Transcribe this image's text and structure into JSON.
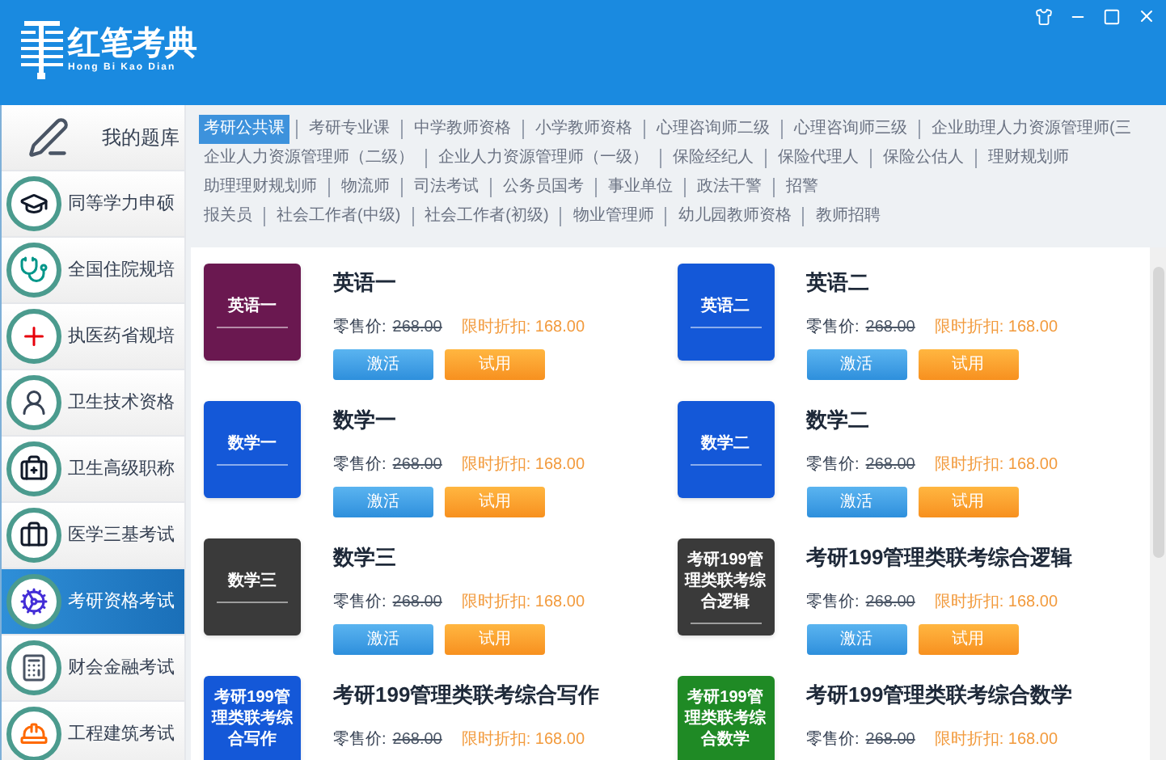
{
  "app": {
    "title": "红笔考典",
    "subtitle": "Hong Bi Kao Dian"
  },
  "sidebar": {
    "items": [
      {
        "label": "我的题库",
        "kind": "featured",
        "selected": false
      },
      {
        "label": "同等学力申硕",
        "kind": "circle",
        "selected": false
      },
      {
        "label": "全国住院规培",
        "kind": "circle",
        "selected": false
      },
      {
        "label": "执医药省规培",
        "kind": "circle",
        "selected": false
      },
      {
        "label": "卫生技术资格",
        "kind": "circle",
        "selected": false
      },
      {
        "label": "卫生高级职称",
        "kind": "circle",
        "selected": false
      },
      {
        "label": "医学三基考试",
        "kind": "circle",
        "selected": false
      },
      {
        "label": "考研资格考试",
        "kind": "circle",
        "selected": true
      },
      {
        "label": "财会金融考试",
        "kind": "circle",
        "selected": false
      },
      {
        "label": "工程建筑考试",
        "kind": "circle",
        "selected": false
      }
    ]
  },
  "categories": [
    [
      {
        "label": "考研公共课",
        "selected": true
      },
      {
        "label": "考研专业课",
        "selected": false
      },
      {
        "label": "中学教师资格",
        "selected": false
      },
      {
        "label": "小学教师资格",
        "selected": false
      },
      {
        "label": "心理咨询师二级",
        "selected": false
      },
      {
        "label": "心理咨询师三级",
        "selected": false
      },
      {
        "label": "企业助理人力资源管理师(三",
        "selected": false
      }
    ],
    [
      {
        "label": "企业人力资源管理师（二级）",
        "selected": false
      },
      {
        "label": "企业人力资源管理师（一级）",
        "selected": false
      },
      {
        "label": "保险经纪人",
        "selected": false
      },
      {
        "label": "保险代理人",
        "selected": false
      },
      {
        "label": "保险公估人",
        "selected": false
      },
      {
        "label": "理财规划师",
        "selected": false
      }
    ],
    [
      {
        "label": "助理理财规划师",
        "selected": false
      },
      {
        "label": "物流师",
        "selected": false
      },
      {
        "label": "司法考试",
        "selected": false
      },
      {
        "label": "公务员国考",
        "selected": false
      },
      {
        "label": "事业单位",
        "selected": false
      },
      {
        "label": "政法干警",
        "selected": false
      },
      {
        "label": "招警",
        "selected": false
      }
    ],
    [
      {
        "label": "报关员",
        "selected": false
      },
      {
        "label": "社会工作者(中级)",
        "selected": false
      },
      {
        "label": "社会工作者(初级)",
        "selected": false
      },
      {
        "label": "物业管理师",
        "selected": false
      },
      {
        "label": "幼儿园教师资格",
        "selected": false
      },
      {
        "label": "教师招聘",
        "selected": false
      }
    ]
  ],
  "products": [
    {
      "cover": "英语一",
      "color": "#6a1850",
      "title": "英语一",
      "retail_label": "零售价:",
      "retail_price": "268.00",
      "discount": "限时折扣: 168.00",
      "buttons": [
        "激活",
        "试用"
      ]
    },
    {
      "cover": "英语二",
      "color": "#1458d8",
      "title": "英语二",
      "retail_label": "零售价:",
      "retail_price": "268.00",
      "discount": "限时折扣: 168.00",
      "buttons": [
        "激活",
        "试用"
      ]
    },
    {
      "cover": "数学一",
      "color": "#1458d8",
      "title": "数学一",
      "retail_label": "零售价:",
      "retail_price": "268.00",
      "discount": "限时折扣: 168.00",
      "buttons": [
        "激活",
        "试用"
      ]
    },
    {
      "cover": "数学二",
      "color": "#1458d8",
      "title": "数学二",
      "retail_label": "零售价:",
      "retail_price": "268.00",
      "discount": "限时折扣: 168.00",
      "buttons": [
        "激活",
        "试用"
      ]
    },
    {
      "cover": "数学三",
      "color": "#3a3a3a",
      "title": "数学三",
      "retail_label": "零售价:",
      "retail_price": "268.00",
      "discount": "限时折扣: 168.00",
      "buttons": [
        "激活",
        "试用"
      ]
    },
    {
      "cover": "考研199管理类联考综合逻辑",
      "color": "#3a3a3a",
      "title": "考研199管理类联考综合逻辑",
      "retail_label": "零售价:",
      "retail_price": "268.00",
      "discount": "限时折扣: 168.00",
      "buttons": [
        "激活",
        "试用"
      ]
    },
    {
      "cover": "考研199管理类联考综合写作",
      "color": "#1458d8",
      "title": "考研199管理类联考综合写作",
      "retail_label": "零售价:",
      "retail_price": "268.00",
      "discount": "限时折扣: 168.00"
    },
    {
      "cover": "考研199管理类联考综合数学",
      "color": "#1f8a25",
      "title": "考研199管理类联考综合数学",
      "retail_label": "零售价:",
      "retail_price": "268.00",
      "discount": "限时折扣: 168.00"
    }
  ]
}
